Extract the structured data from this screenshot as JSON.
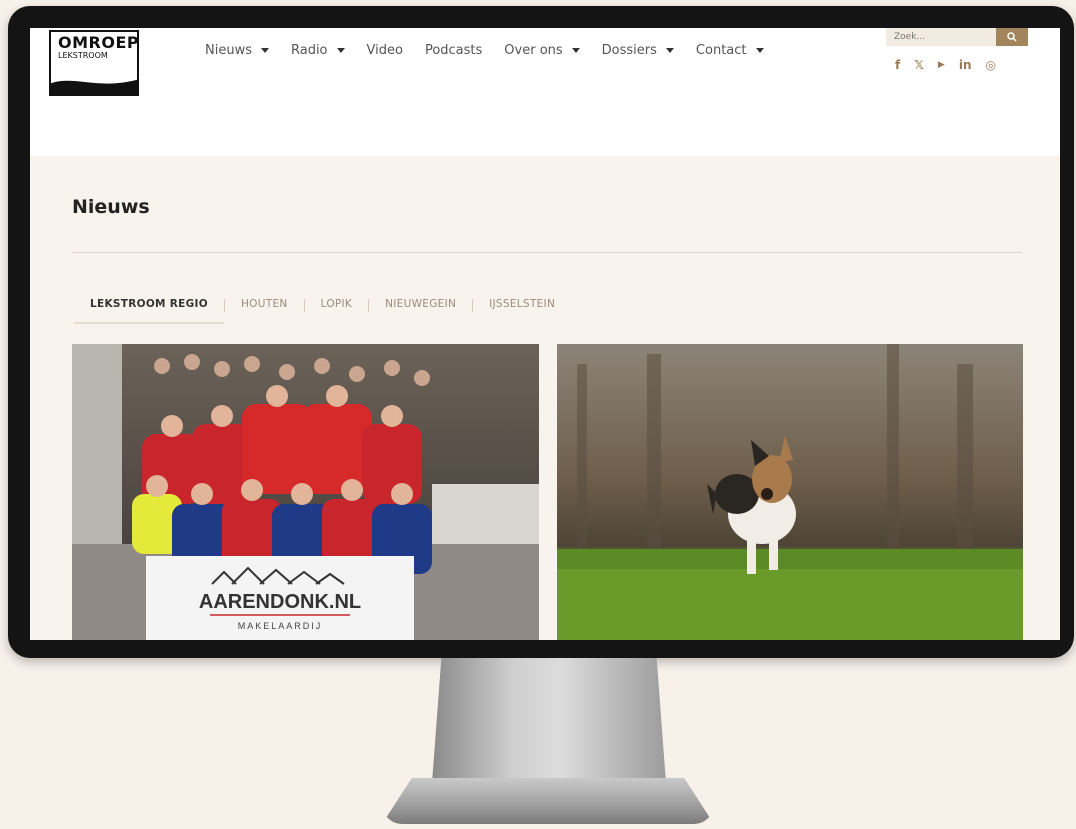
{
  "brand": {
    "logo_line1": "OMROEP",
    "logo_line2": "LEKSTROOM"
  },
  "nav": {
    "items": [
      {
        "label": "Nieuws",
        "has_dropdown": true
      },
      {
        "label": "Radio",
        "has_dropdown": true
      },
      {
        "label": "Video",
        "has_dropdown": false
      },
      {
        "label": "Podcasts",
        "has_dropdown": false
      },
      {
        "label": "Over ons",
        "has_dropdown": true
      },
      {
        "label": "Dossiers",
        "has_dropdown": true
      },
      {
        "label": "Contact",
        "has_dropdown": true
      }
    ]
  },
  "search": {
    "placeholder": "Zoek..."
  },
  "social": [
    "facebook-icon",
    "x-icon",
    "youtube-icon",
    "linkedin-icon",
    "instagram-icon"
  ],
  "social_glyphs": {
    "facebook": "f",
    "x": "𝕏",
    "youtube": "▶",
    "linkedin": "in",
    "instagram": "◎"
  },
  "page": {
    "title": "Nieuws"
  },
  "tabs": [
    {
      "label": "LEKSTROOM REGIO",
      "active": true
    },
    {
      "label": "HOUTEN",
      "active": false
    },
    {
      "label": "LOPIK",
      "active": false
    },
    {
      "label": "NIEUWEGEIN",
      "active": false
    },
    {
      "label": "IJSSELSTEIN",
      "active": false
    }
  ],
  "articles": [
    {
      "image": "team-celebration-photo",
      "sign_main": "AARENDONK.NL",
      "sign_sub": "MAKELAARDIJ"
    },
    {
      "image": "running-dog-photo"
    }
  ],
  "colors": {
    "accent": "#a2855d",
    "page_bg": "#f8f3ec",
    "bezel": "#141414"
  }
}
